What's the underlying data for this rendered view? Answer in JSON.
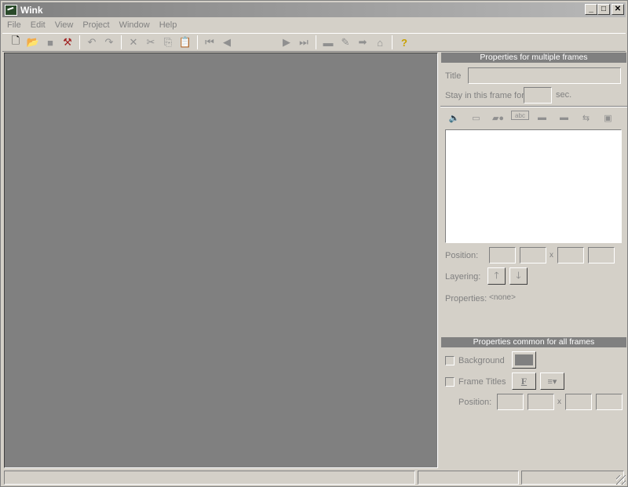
{
  "window": {
    "title": "Wink",
    "min": "_",
    "max": "□",
    "close": "✕"
  },
  "menu": [
    "File",
    "Edit",
    "View",
    "Project",
    "Window",
    "Help"
  ],
  "toolbar": {
    "new": "🗋",
    "open": "📂",
    "save": "■",
    "tools": "⚒",
    "undo": "↶",
    "redo": "↷",
    "delete": "✕",
    "cut": "✂",
    "copy": "⎘",
    "paste": "📋",
    "first": "⏮",
    "prev": "◀",
    "next": "▶",
    "last": "⏭",
    "frame": "▬",
    "script": "✎",
    "go": "➡",
    "home": "⌂",
    "help": "?"
  },
  "multi": {
    "header": "Properties for multiple frames",
    "title_label": "Title",
    "stay_label": "Stay in this frame for",
    "sec_label": "sec.",
    "position_label": "Position:",
    "x_label": "x",
    "layering_label": "Layering:",
    "properties_label": "Properties:",
    "properties_value": "<none>",
    "up": "🡑",
    "down": "🡓"
  },
  "common": {
    "header": "Properties common for all frames",
    "background_label": "Background",
    "frame_titles_label": "Frame Titles",
    "font_btn": "F",
    "align_btn": "≡▾",
    "position_label": "Position:",
    "x_label": "x"
  },
  "frame_icons": [
    "audio-icon",
    "callout-icon",
    "shape-icon",
    "text-icon",
    "box-icon",
    "note-icon",
    "link-icon",
    "button-icon"
  ]
}
